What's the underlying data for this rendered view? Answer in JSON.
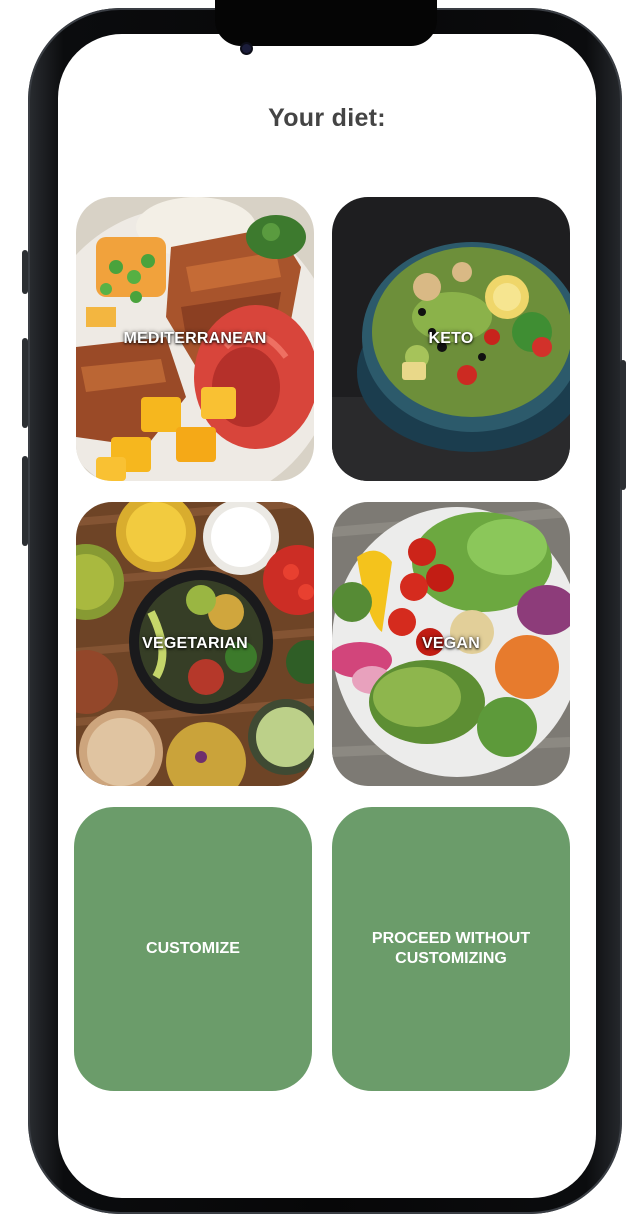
{
  "header": {
    "title": "Your diet:"
  },
  "diets": [
    {
      "label": "MEDITERRANEAN",
      "image": "grilled-fish-vegetables-photo"
    },
    {
      "label": "KETO",
      "image": "salad-bowl-photo"
    },
    {
      "label": "VEGETARIAN",
      "image": "vegetarian-spread-photo"
    },
    {
      "label": "VEGAN",
      "image": "vegan-bowl-photo"
    }
  ],
  "actions": {
    "customize_label": "CUSTOMIZE",
    "proceed_label": "PROCEED WITHOUT CUSTOMIZING"
  },
  "colors": {
    "accent": "#6b9c6a",
    "title": "#444444",
    "label": "#ffffff"
  }
}
